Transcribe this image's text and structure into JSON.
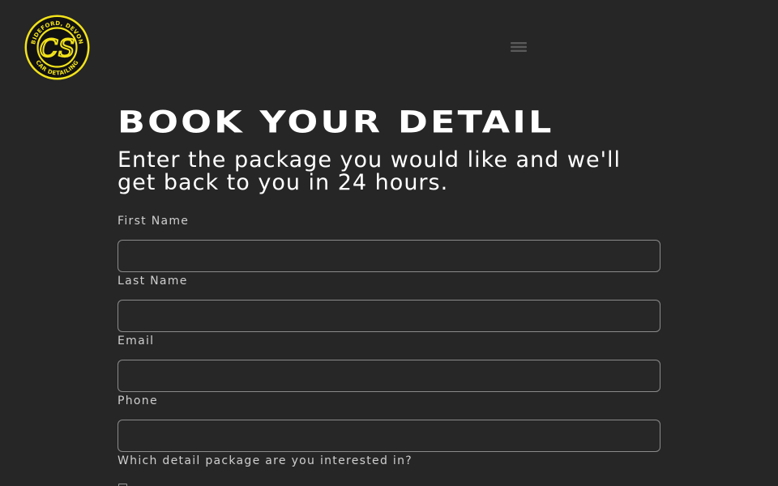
{
  "header": {
    "logo": {
      "top_text": "BIDEFORD, DEVON",
      "bottom_text": "CAR DETAILING",
      "monogram": "CS",
      "accent_color": "#f2e21a"
    },
    "menu_icon": "hamburger-icon"
  },
  "main": {
    "title": "BOOK YOUR DETAIL",
    "subtitle": "Enter the package you would like and we'll get back to you in 24 hours."
  },
  "form": {
    "fields": [
      {
        "label": "First Name",
        "value": "",
        "placeholder": ""
      },
      {
        "label": "Last Name",
        "value": "",
        "placeholder": ""
      },
      {
        "label": "Email",
        "value": "",
        "placeholder": ""
      },
      {
        "label": "Phone",
        "value": "",
        "placeholder": ""
      }
    ],
    "package_question": "Which detail package are you interested in?"
  },
  "colors": {
    "background": "#262626",
    "text": "#ffffff",
    "label": "#cfcfcf",
    "input_border": "#8a8a8a"
  }
}
